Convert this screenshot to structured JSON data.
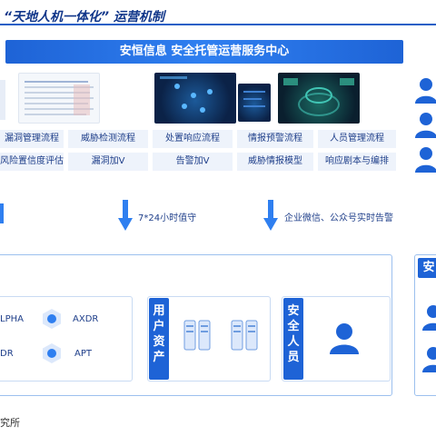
{
  "title": "“天地人机一体化” 运营机制",
  "ops_center": {
    "title": "安恒信息 安全托管运营服务中心"
  },
  "screenshot_icons": [
    "dashboard-list-screenshot",
    "threat-map-screenshot",
    "security-ops-screen"
  ],
  "grid_row1": [
    "漏洞管理流程",
    "威胁检测流程",
    "处置响应流程",
    "情报预警流程",
    "人员管理流程"
  ],
  "grid_row2": [
    "风险置信度评估",
    "漏洞加V",
    "告警加V",
    "威胁情报模型",
    "响应剧本与编排"
  ],
  "arrows": {
    "left_text": "7*24小时值守",
    "right_text": "企业微信、公众号实时告警"
  },
  "products": {
    "alpha": "LPHA",
    "axdr": "AXDR",
    "dr": "DR",
    "apt": "APT"
  },
  "blocks": {
    "assets": "用户资产",
    "people": "安全人员",
    "right": "安"
  },
  "source": "究所",
  "colors": {
    "primary": "#1e63d6",
    "text": "#1f3f8a",
    "cell_bg": "#eef3fb"
  }
}
